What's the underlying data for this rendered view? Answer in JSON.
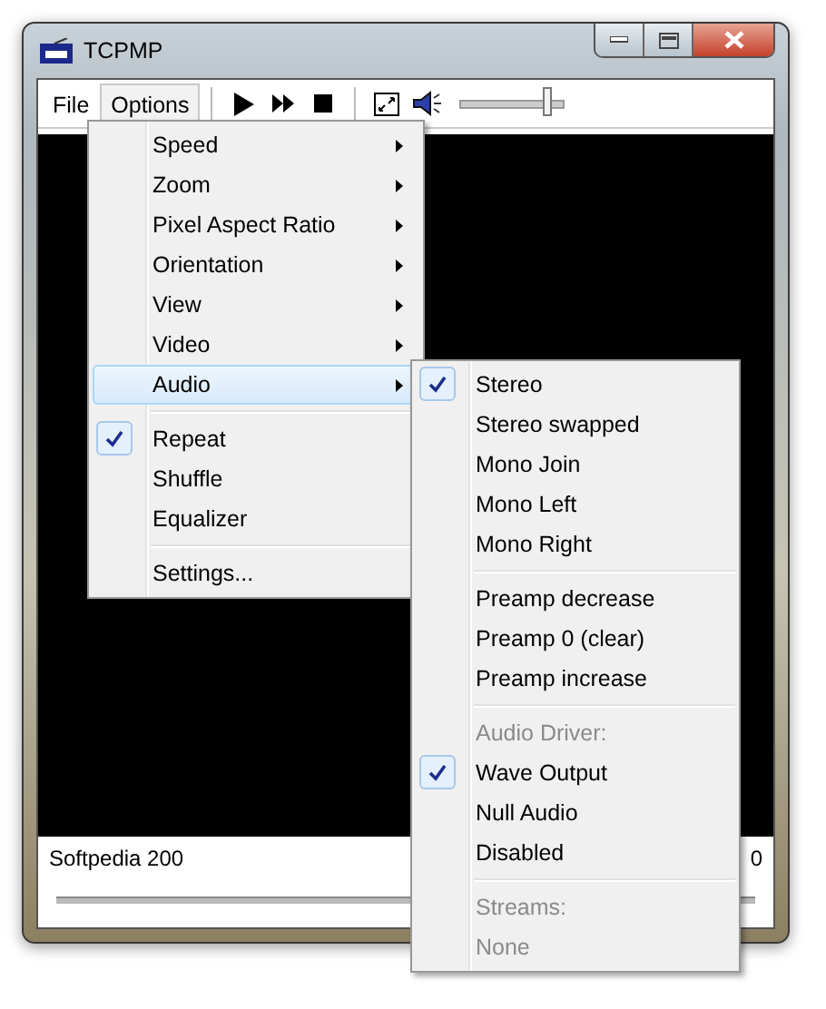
{
  "window": {
    "title": "TCPMP"
  },
  "menubar": [
    {
      "label": "File",
      "selected": false
    },
    {
      "label": "Options",
      "selected": true
    }
  ],
  "volume": {
    "level": 0.85
  },
  "status": {
    "title": "Softpedia 200",
    "time": "0"
  },
  "options_menu": [
    {
      "kind": "item",
      "label": "Speed",
      "submenu": true,
      "checked": false,
      "selected": false
    },
    {
      "kind": "item",
      "label": "Zoom",
      "submenu": true,
      "checked": false,
      "selected": false
    },
    {
      "kind": "item",
      "label": "Pixel Aspect Ratio",
      "submenu": true,
      "checked": false,
      "selected": false
    },
    {
      "kind": "item",
      "label": "Orientation",
      "submenu": true,
      "checked": false,
      "selected": false
    },
    {
      "kind": "item",
      "label": "View",
      "submenu": true,
      "checked": false,
      "selected": false
    },
    {
      "kind": "item",
      "label": "Video",
      "submenu": true,
      "checked": false,
      "selected": false
    },
    {
      "kind": "item",
      "label": "Audio",
      "submenu": true,
      "checked": false,
      "selected": true
    },
    {
      "kind": "separator"
    },
    {
      "kind": "item",
      "label": "Repeat",
      "submenu": false,
      "checked": true,
      "selected": false
    },
    {
      "kind": "item",
      "label": "Shuffle",
      "submenu": false,
      "checked": false,
      "selected": false
    },
    {
      "kind": "item",
      "label": "Equalizer",
      "submenu": false,
      "checked": false,
      "selected": false
    },
    {
      "kind": "separator"
    },
    {
      "kind": "item",
      "label": "Settings...",
      "submenu": false,
      "checked": false,
      "selected": false
    }
  ],
  "audio_menu": [
    {
      "kind": "item",
      "label": "Stereo",
      "submenu": false,
      "checked": true,
      "selected": false
    },
    {
      "kind": "item",
      "label": "Stereo swapped",
      "submenu": false,
      "checked": false,
      "selected": false
    },
    {
      "kind": "item",
      "label": "Mono Join",
      "submenu": false,
      "checked": false,
      "selected": false
    },
    {
      "kind": "item",
      "label": "Mono Left",
      "submenu": false,
      "checked": false,
      "selected": false
    },
    {
      "kind": "item",
      "label": "Mono Right",
      "submenu": false,
      "checked": false,
      "selected": false
    },
    {
      "kind": "separator"
    },
    {
      "kind": "item",
      "label": "Preamp decrease",
      "submenu": false,
      "checked": false,
      "selected": false
    },
    {
      "kind": "item",
      "label": "Preamp 0 (clear)",
      "submenu": false,
      "checked": false,
      "selected": false
    },
    {
      "kind": "item",
      "label": "Preamp increase",
      "submenu": false,
      "checked": false,
      "selected": false
    },
    {
      "kind": "separator"
    },
    {
      "kind": "header",
      "label": "Audio Driver:"
    },
    {
      "kind": "item",
      "label": "Wave Output",
      "submenu": false,
      "checked": true,
      "selected": false
    },
    {
      "kind": "item",
      "label": "Null Audio",
      "submenu": false,
      "checked": false,
      "selected": false
    },
    {
      "kind": "item",
      "label": "Disabled",
      "submenu": false,
      "checked": false,
      "selected": false
    },
    {
      "kind": "separator"
    },
    {
      "kind": "header",
      "label": "Streams:"
    },
    {
      "kind": "header",
      "label": "None"
    }
  ]
}
